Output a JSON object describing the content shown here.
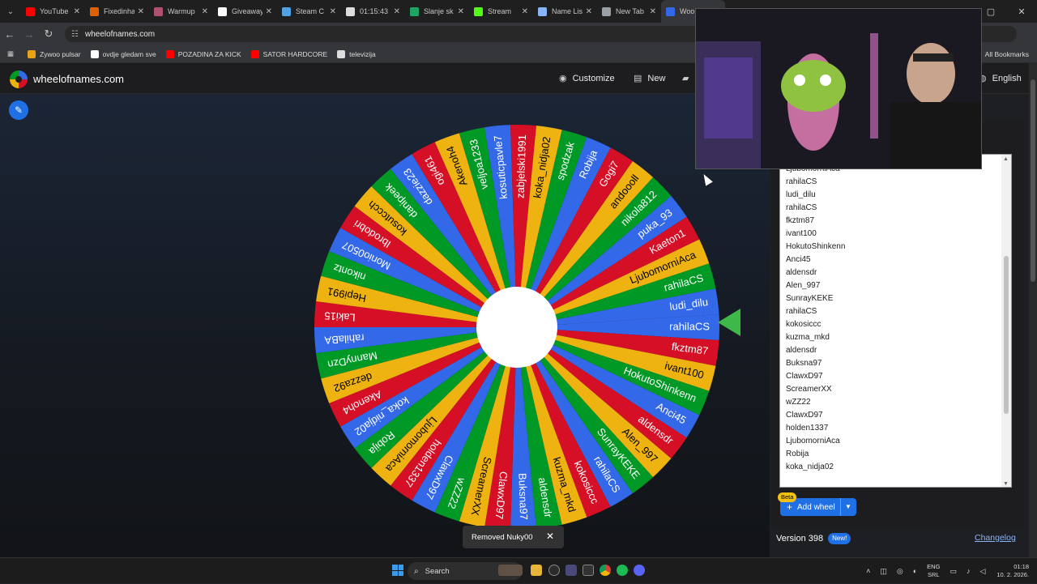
{
  "tabs": [
    {
      "label": "YouTube",
      "color": "#ff0000"
    },
    {
      "label": "Fixedinha",
      "color": "#e06000"
    },
    {
      "label": "Warmup",
      "color": "#b05070"
    },
    {
      "label": "Giveaway",
      "color": "#ffffff"
    },
    {
      "label": "Steam C",
      "color": "#4fa3e3"
    },
    {
      "label": "01:15:43",
      "color": "#dddddd"
    },
    {
      "label": "Slanje sk",
      "color": "#1fa463"
    },
    {
      "label": "Stream",
      "color": "#53fc18"
    },
    {
      "label": "Name Lis",
      "color": "#8ab4f8"
    },
    {
      "label": "New Tab",
      "color": "#9aa0a6"
    },
    {
      "label": "Woo",
      "color": "#3369e8"
    }
  ],
  "tab_close": "✕",
  "address": {
    "url": "wheelofnames.com"
  },
  "bookmarks": [
    {
      "label": "Zywoo pulsar",
      "color": "#e8a317"
    },
    {
      "label": "ovdje gledam sve",
      "color": "#ffffff"
    },
    {
      "label": "POZADINA ZA KICK",
      "color": "#ff0000"
    },
    {
      "label": "SATOR HARDCORE",
      "color": "#ff0000"
    },
    {
      "label": "televizija",
      "color": "#dddddd"
    }
  ],
  "bookmarks_right": "All Bookmarks",
  "site": {
    "brand": "wheelofnames.com",
    "customize": "Customize",
    "new": "New",
    "language": "English"
  },
  "wheel": {
    "colors": [
      "#3369e8",
      "#d50f25",
      "#eeb211",
      "#009925"
    ],
    "labels": [
      "rahilaCS",
      "fkztm87",
      "ivant100",
      "HokutoShinkenn",
      "Anci45",
      "aldensdr",
      "Alen_997",
      "SunrayKEKE",
      "rahilaCS",
      "kokosiccc",
      "kuzma_mkd",
      "aldensdr",
      "Buksna97",
      "ClawxD97",
      "ScreamerXX",
      "wZZ22",
      "ClawxD97",
      "holden1337",
      "LjubomorniAca",
      "Robija",
      "koka_nidja02",
      "Akenoh4",
      "dezza92",
      "MannyDzn",
      "rahilaBA",
      "Laki15",
      "Hepi991",
      "nikontz",
      "Monio0507",
      "Ibrodobri",
      "kosutccch",
      "danipeek",
      "dazzie23",
      "ogi461",
      "Akenoh4",
      "veljoa1233",
      "kosuticpavle7",
      "zabjelski1991",
      "koka_nidja02",
      "spodzak",
      "Robija",
      "Gogi7",
      "andoooll",
      "nikola812",
      "puka_93",
      "Kaeton1",
      "LjubomorniAca",
      "rahilaCS",
      "ludi_dilu"
    ]
  },
  "names_list": [
    "Kaeton1",
    "LjubomorniAca",
    "rahilaCS",
    "ludi_dilu",
    "rahilaCS",
    "fkztm87",
    "ivant100",
    "HokutoShinkenn",
    "Anci45",
    "aldensdr",
    "Alen_997",
    "SunrayKEKE",
    "rahilaCS",
    "kokosiccc",
    "kuzma_mkd",
    "aldensdr",
    "Buksna97",
    "ClawxD97",
    "ScreamerXX",
    "wZZ22",
    "ClawxD97",
    "holden1337",
    "LjubomorniAca",
    "Robija",
    "koka_nidja02"
  ],
  "beta_badge": "Beta",
  "add_wheel": "Add wheel",
  "version": "Version 398",
  "new_badge": "New!",
  "changelog": "Changelog",
  "toast": {
    "message": "Removed Nuky00",
    "close": "✕"
  },
  "taskbar": {
    "search": "Search",
    "lang_top": "ENG",
    "lang_bottom": "SRL",
    "time": "01:18",
    "date": "10. 2. 2026."
  }
}
